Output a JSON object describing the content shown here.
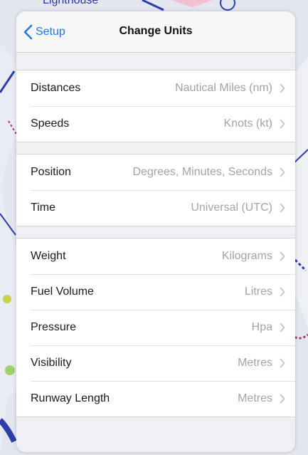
{
  "map": {
    "labels": [
      "Lighthouse"
    ]
  },
  "navbar": {
    "back_label": "Setup",
    "back_icon": "chevron-left-icon",
    "title": "Change Units"
  },
  "groups": [
    {
      "rows": [
        {
          "label": "Distances",
          "value": "Nautical Miles (nm)"
        },
        {
          "label": "Speeds",
          "value": "Knots (kt)"
        }
      ]
    },
    {
      "rows": [
        {
          "label": "Position",
          "value": "Degrees, Minutes, Seconds"
        },
        {
          "label": "Time",
          "value": "Universal (UTC)"
        }
      ]
    },
    {
      "rows": [
        {
          "label": "Weight",
          "value": "Kilograms"
        },
        {
          "label": "Fuel Volume",
          "value": "Litres"
        },
        {
          "label": "Pressure",
          "value": "Hpa"
        },
        {
          "label": "Visibility",
          "value": "Metres"
        },
        {
          "label": "Runway Length",
          "value": "Metres"
        }
      ]
    }
  ],
  "colors": {
    "accent": "#1e78f0",
    "secondary_text": "#a3a3a8",
    "background": "#efeff4"
  }
}
